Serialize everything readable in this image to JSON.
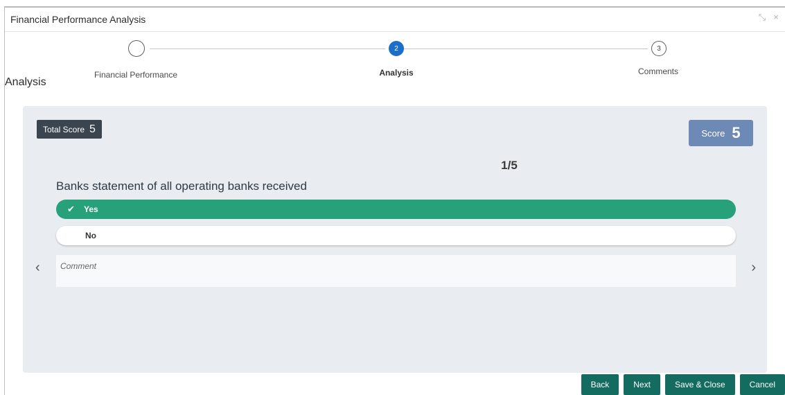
{
  "window": {
    "title": "Financial Performance Analysis",
    "controls": {
      "minimize_icon": "⤡",
      "close_icon": "×"
    }
  },
  "stepper": {
    "steps": [
      {
        "number": "",
        "label": "Financial Performance",
        "state": "completed"
      },
      {
        "number": "2",
        "label": "Analysis",
        "state": "active"
      },
      {
        "number": "3",
        "label": "Comments",
        "state": "pending"
      }
    ]
  },
  "section": {
    "heading": "Analysis"
  },
  "scoring": {
    "total_score_label": "Total Score",
    "total_score_value": "5",
    "score_label": "Score",
    "score_value": "5",
    "counter": "1/5",
    "question": "Banks statement of all operating banks received",
    "options": [
      {
        "label": "Yes",
        "selected": true
      },
      {
        "label": "No",
        "selected": false
      }
    ],
    "comment_placeholder": "Comment",
    "prev_icon": "‹",
    "next_icon": "›"
  },
  "footer": {
    "back_label": "Back",
    "next_label": "Next",
    "save_close_label": "Save & Close",
    "cancel_label": "Cancel"
  },
  "colors": {
    "active_step": "#1a6fcb",
    "selected_option": "#27a17a",
    "score_card": "#6d8ab6",
    "total_score_badge": "#3a4550",
    "footer_button": "#146b5f"
  }
}
